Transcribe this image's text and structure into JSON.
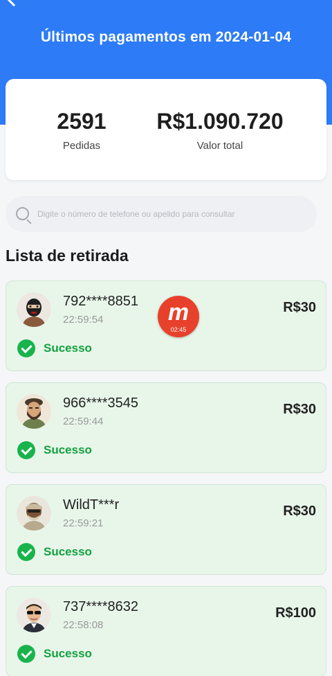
{
  "header": {
    "title": "Últimos pagamentos em 2024-01-04",
    "bg_color": "#2d7bf6"
  },
  "summary": {
    "orders_value": "2591",
    "orders_label": "Pedidas",
    "total_value": "R$1.090.720",
    "total_label": "Valor total"
  },
  "search": {
    "placeholder": "Digite o número de telefone ou apelido para consultar"
  },
  "section_title": "Lista de retirada",
  "withdrawals": [
    {
      "name": "792****8851",
      "time": "22:59:54",
      "amount": "R$30",
      "status": "Sucesso",
      "avatar": "masked-avatar"
    },
    {
      "name": "966****3545",
      "time": "22:59:44",
      "amount": "R$30",
      "status": "Sucesso",
      "avatar": "bearded-avatar"
    },
    {
      "name": "WildT***r",
      "time": "22:59:21",
      "amount": "R$30",
      "status": "Sucesso",
      "avatar": "bandana-avatar"
    },
    {
      "name": "737****8632",
      "time": "22:58:08",
      "amount": "R$100",
      "status": "Sucesso",
      "avatar": "sunglasses-avatar"
    }
  ],
  "recording_badge": {
    "logo": "m",
    "time": "02:45",
    "color": "#e8412b"
  },
  "status_color": "#19b34c"
}
